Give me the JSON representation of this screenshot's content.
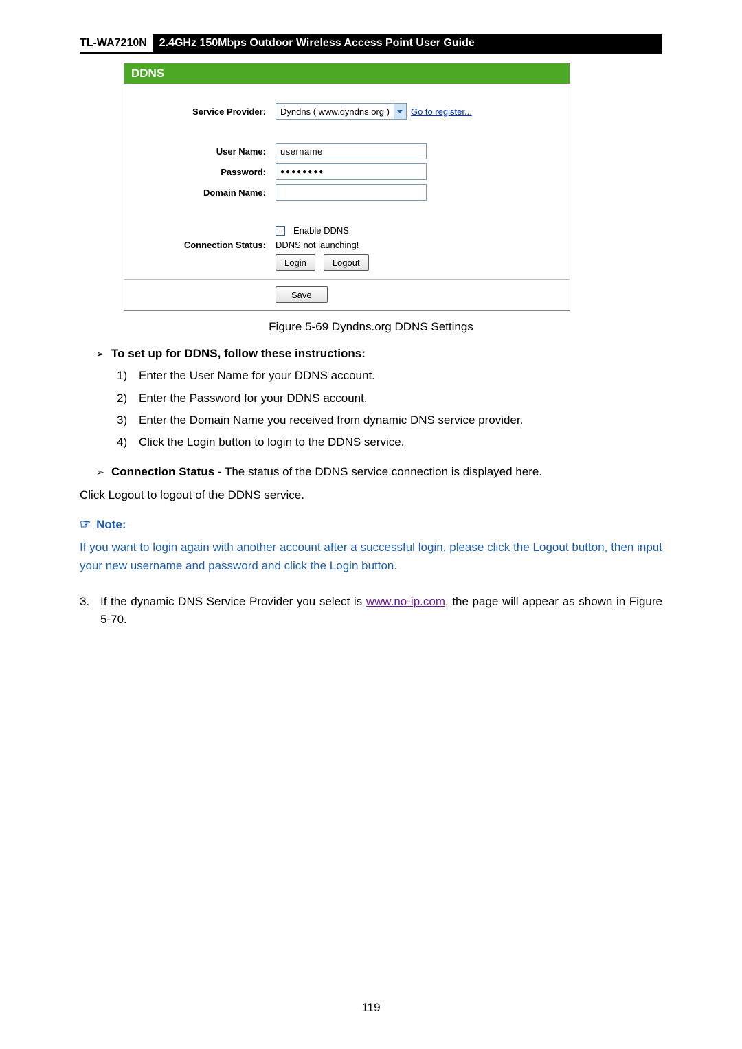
{
  "header": {
    "model": "TL-WA7210N",
    "title": "2.4GHz 150Mbps Outdoor Wireless Access Point User Guide"
  },
  "ddns": {
    "panel_title": "DDNS",
    "labels": {
      "service_provider": "Service Provider:",
      "user_name": "User Name:",
      "password": "Password:",
      "domain_name": "Domain Name:",
      "connection_status": "Connection Status:"
    },
    "values": {
      "provider_selected": "Dyndns ( www.dyndns.org )",
      "register_link": "Go to register...",
      "username": "username",
      "password_mask": "●●●●●●●●",
      "domain": "",
      "enable_label": "Enable DDNS",
      "status_text": "DDNS not launching!",
      "login_btn": "Login",
      "logout_btn": "Logout",
      "save_btn": "Save"
    }
  },
  "caption": "Figure 5-69 Dyndns.org DDNS Settings",
  "instructions_heading": "To set up for DDNS, follow these instructions:",
  "steps": [
    "Enter the User Name for your DDNS account.",
    "Enter the Password for your DDNS account.",
    "Enter the Domain Name you received from dynamic DNS service provider.",
    "Click the Login button to login to the DDNS service."
  ],
  "conn_status_label": "Connection Status",
  "conn_status_desc": " - The status of the DDNS service connection is displayed here.",
  "logout_para_pre": "Click ",
  "logout_bold": "Logout",
  "logout_para_post": " to logout of the DDNS service.",
  "note_label": "Note:",
  "note_body": "If you want to login again with another account after a successful login, please click the Logout button, then input your new username and password and click the Login button.",
  "item3_num": "3.",
  "item3_pre": "If the dynamic DNS ",
  "item3_bold": "Service Provider",
  "item3_mid": " you select is ",
  "item3_link": "www.no-ip.com",
  "item3_post": ", the page will appear as shown in Figure 5-70.",
  "page_number": "119"
}
